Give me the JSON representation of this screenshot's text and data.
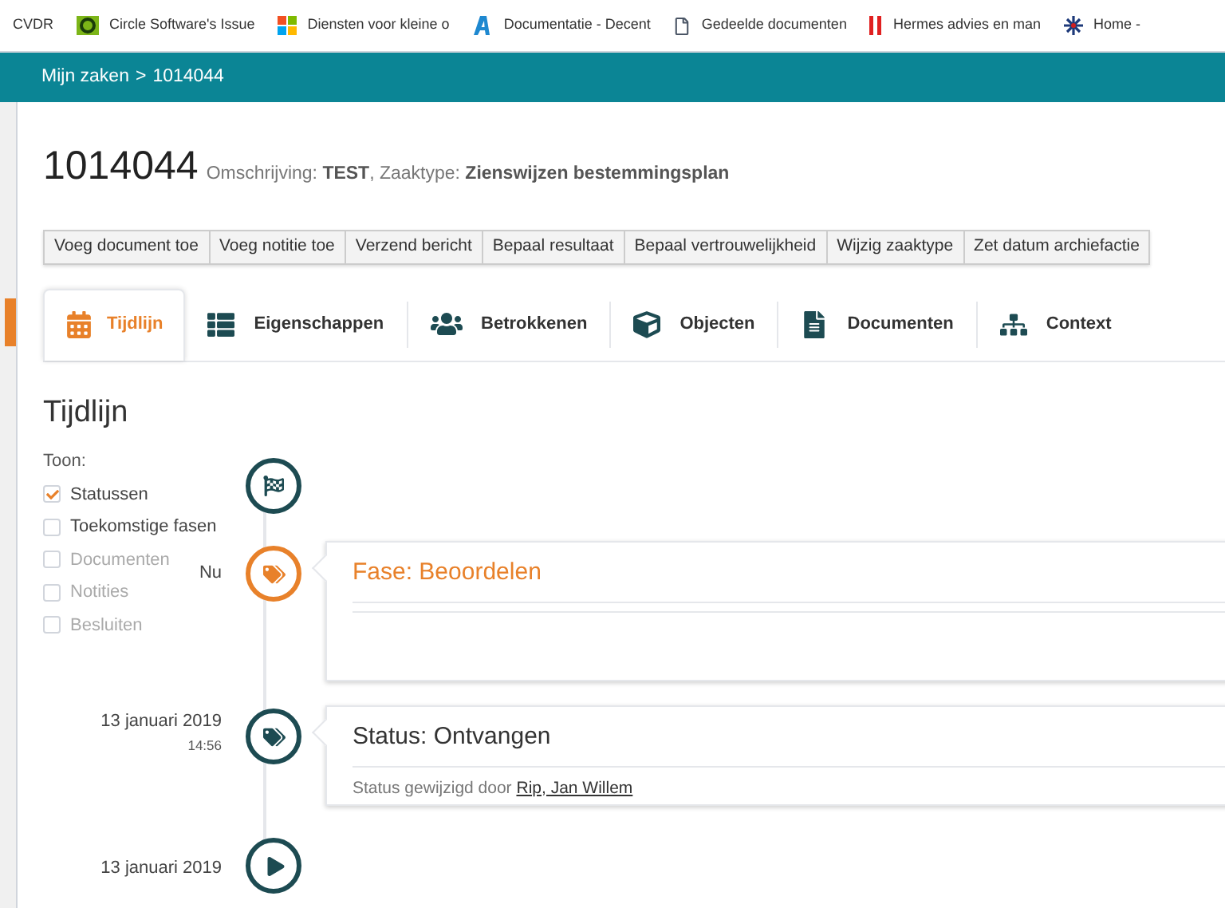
{
  "bookmarks": [
    {
      "label": "CVDR",
      "kind": "none"
    },
    {
      "label": "Circle Software's Issue",
      "kind": "circle"
    },
    {
      "label": "Diensten voor kleine o",
      "kind": "windows"
    },
    {
      "label": "Documentatie - Decent",
      "kind": "letter"
    },
    {
      "label": "Gedeelde documenten",
      "kind": "page"
    },
    {
      "label": "Hermes advies en man",
      "kind": "bars"
    },
    {
      "label": "Home -",
      "kind": "star"
    }
  ],
  "breadcrumb": {
    "items": [
      "Mijn zaken",
      "1014044"
    ],
    "separator": ">"
  },
  "case": {
    "number": "1014044",
    "summary": "Omschrijving: **TEST**, Zaaktype: **Zienswijzen bestemmingsplan**"
  },
  "actions": [
    "Voeg document toe",
    "Voeg notitie toe",
    "Verzend bericht",
    "Bepaal resultaat",
    "Bepaal vertrouwelijkheid",
    "Wijzig zaaktype",
    "Zet datum archiefactie"
  ],
  "tabs": [
    {
      "label": "Tijdlijn",
      "kind": "calendar",
      "selected": true
    },
    {
      "label": "Eigenschappen",
      "kind": "list",
      "selected": false
    },
    {
      "label": "Betrokkenen",
      "kind": "users",
      "selected": false
    },
    {
      "label": "Objecten",
      "kind": "cube",
      "selected": false
    },
    {
      "label": "Documenten",
      "kind": "file",
      "selected": false
    },
    {
      "label": "Context",
      "kind": "sitemap",
      "selected": false
    }
  ],
  "timeline": {
    "title": "Tijdlijn",
    "filter_label": "Toon:",
    "filters": [
      {
        "label": "Statussen",
        "checked": true,
        "disabled": false
      },
      {
        "label": "Toekomstige fasen",
        "checked": false,
        "disabled": false
      },
      {
        "label": "Documenten",
        "checked": false,
        "disabled": true
      },
      {
        "label": "Notities",
        "checked": false,
        "disabled": true
      },
      {
        "label": "Besluiten",
        "checked": false,
        "disabled": true
      }
    ],
    "events": [
      {
        "kind": "start"
      },
      {
        "kind": "phase",
        "date": "Nu",
        "title": "Fase: Beoordelen"
      },
      {
        "kind": "status",
        "date": "13 januari 2019",
        "time": "14:56",
        "title": "Status: Ontvangen",
        "text": "Status gewijzigd door",
        "link": "Rip, Jan Willem"
      },
      {
        "kind": "begin",
        "date": "13 januari 2019"
      }
    ]
  }
}
